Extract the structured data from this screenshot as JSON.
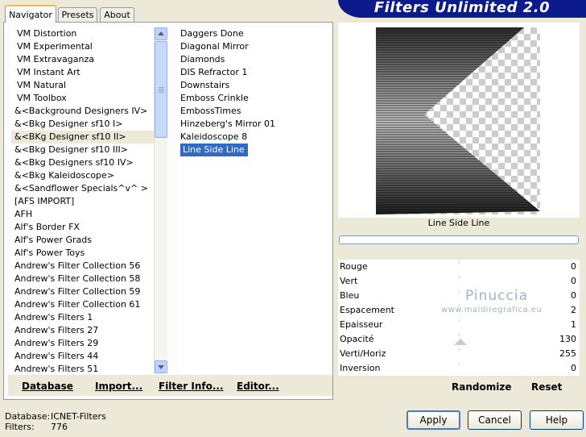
{
  "title": "Filters Unlimited 2.0",
  "tabs": [
    "Navigator",
    "Presets",
    "About"
  ],
  "categories": [
    "VM Distortion",
    "VM Experimental",
    "VM Extravaganza",
    "VM Instant Art",
    "VM Natural",
    "VM Toolbox",
    "&<Background Designers IV>",
    "&<Bkg Designer sf10 I>",
    "&<BKg Designer sf10 II>",
    "&<Bkg Designer sf10 III>",
    "&<Bkg Designers sf10 IV>",
    "&<Bkg Kaleidoscope>",
    "&<Sandflower Specials^v^ >",
    "[AFS IMPORT]",
    "AFH",
    "Alf's Border FX",
    "Alf's Power Grads",
    "Alf's Power Toys",
    "Andrew's Filter Collection 56",
    "Andrew's Filter Collection 58",
    "Andrew's Filter Collection 59",
    "Andrew's Filter Collection 61",
    "Andrew's Filters 1",
    "Andrew's Filters 27",
    "Andrew's Filters 29",
    "Andrew's Filters 44",
    "Andrew's Filters 51"
  ],
  "filters": [
    "Daggers Done",
    "Diagonal Mirror",
    "Diamonds",
    "DIS Refractor 1",
    "Downstairs",
    "Emboss Crinkle",
    "EmbossTimes",
    "Hinzeberg's Mirror 01",
    "Kaleidoscope 8",
    "Line Side Line"
  ],
  "link_buttons": {
    "database": "Database",
    "import": "Import...",
    "filter_info": "Filter Info...",
    "editor": "Editor..."
  },
  "preview_label": "Line Side Line",
  "params": [
    {
      "name": "Rouge",
      "value": "0"
    },
    {
      "name": "Vert",
      "value": "0"
    },
    {
      "name": "Bleu",
      "value": "0"
    },
    {
      "name": "Espacement",
      "value": "2"
    },
    {
      "name": "Epaisseur",
      "value": "1"
    },
    {
      "name": "Opacité",
      "value": "130"
    },
    {
      "name": "Verti/Horiz",
      "value": "255"
    },
    {
      "name": "Inversion",
      "value": "0"
    }
  ],
  "watermark": {
    "line1": "Pinuccia",
    "line2": "www.maidiregrafica.eu"
  },
  "preset_buttons": {
    "randomize": "Randomize",
    "reset": "Reset"
  },
  "status": {
    "database_label": "Database:",
    "database_value": "ICNET-Filters",
    "filters_label": "Filters:",
    "filters_value": "776"
  },
  "buttons": {
    "apply": "Apply",
    "cancel": "Cancel",
    "help": "Help"
  },
  "colors": {
    "selection": "#316ac5",
    "banner": "#0b1b8c",
    "background": "#ece9d8"
  }
}
